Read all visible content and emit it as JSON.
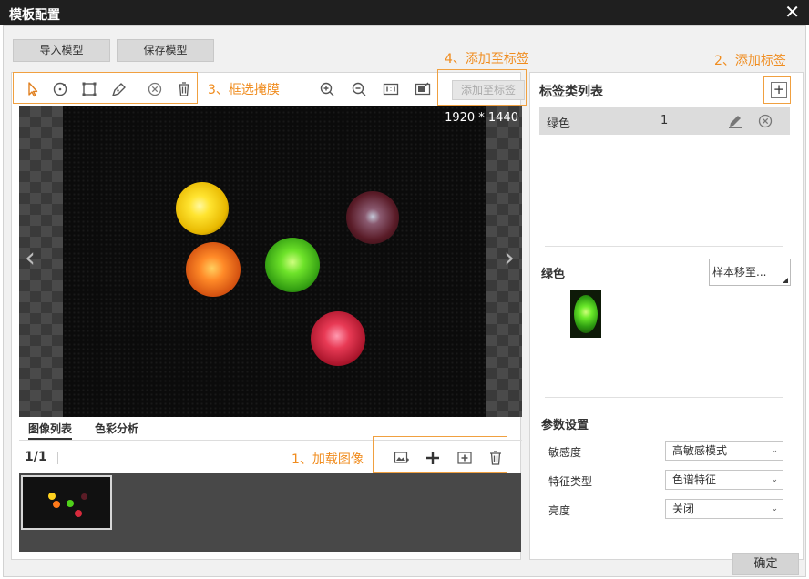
{
  "window": {
    "title": "模板配置",
    "close_glyph": "✕"
  },
  "top_buttons": {
    "import": "导入模型",
    "save": "保存模型"
  },
  "toolbar": {
    "tools": [
      "select-arrow-icon",
      "circle-tool-icon",
      "rectangle-tool-icon",
      "polygon-pen-icon",
      "clear-icon",
      "delete-icon",
      "zoom-in-icon",
      "zoom-out-icon",
      "actual-size-icon",
      "fit-window-icon"
    ],
    "add_to_tag_label": "添加至标签"
  },
  "annotations": {
    "step1": "1、加载图像",
    "step2": "2、添加标签",
    "step3": "3、框选掩膜",
    "step4": "4、添加至标签",
    "color": "#f08c1e"
  },
  "canvas": {
    "resolution": "1920 * 1440",
    "prev_arrow": "‹",
    "next_arrow": "›",
    "balls": [
      "yellow",
      "orange",
      "green",
      "dark-red",
      "red"
    ],
    "ball_colors": {
      "yellow": "#ffd21f",
      "orange": "#ff7a1a",
      "green": "#4fd11a",
      "dark-red": "#5a1c26",
      "red": "#d62a3c"
    }
  },
  "tabs": {
    "image_list": "图像列表",
    "color_analysis": "色彩分析"
  },
  "image_list": {
    "counter": "1/1"
  },
  "right": {
    "tag_list_title": "标签类列表",
    "add_tag_glyph": "+",
    "tags": [
      {
        "name": "绿色",
        "count": "1"
      }
    ],
    "selected_tag_title": "绿色",
    "move_sample_label": "样本移至...",
    "params_title": "参数设置",
    "params": [
      {
        "label": "敏感度",
        "value": "高敏感模式"
      },
      {
        "label": "特征类型",
        "value": "色谱特征"
      },
      {
        "label": "亮度",
        "value": "关闭"
      }
    ]
  },
  "footer": {
    "ok": "确定"
  }
}
